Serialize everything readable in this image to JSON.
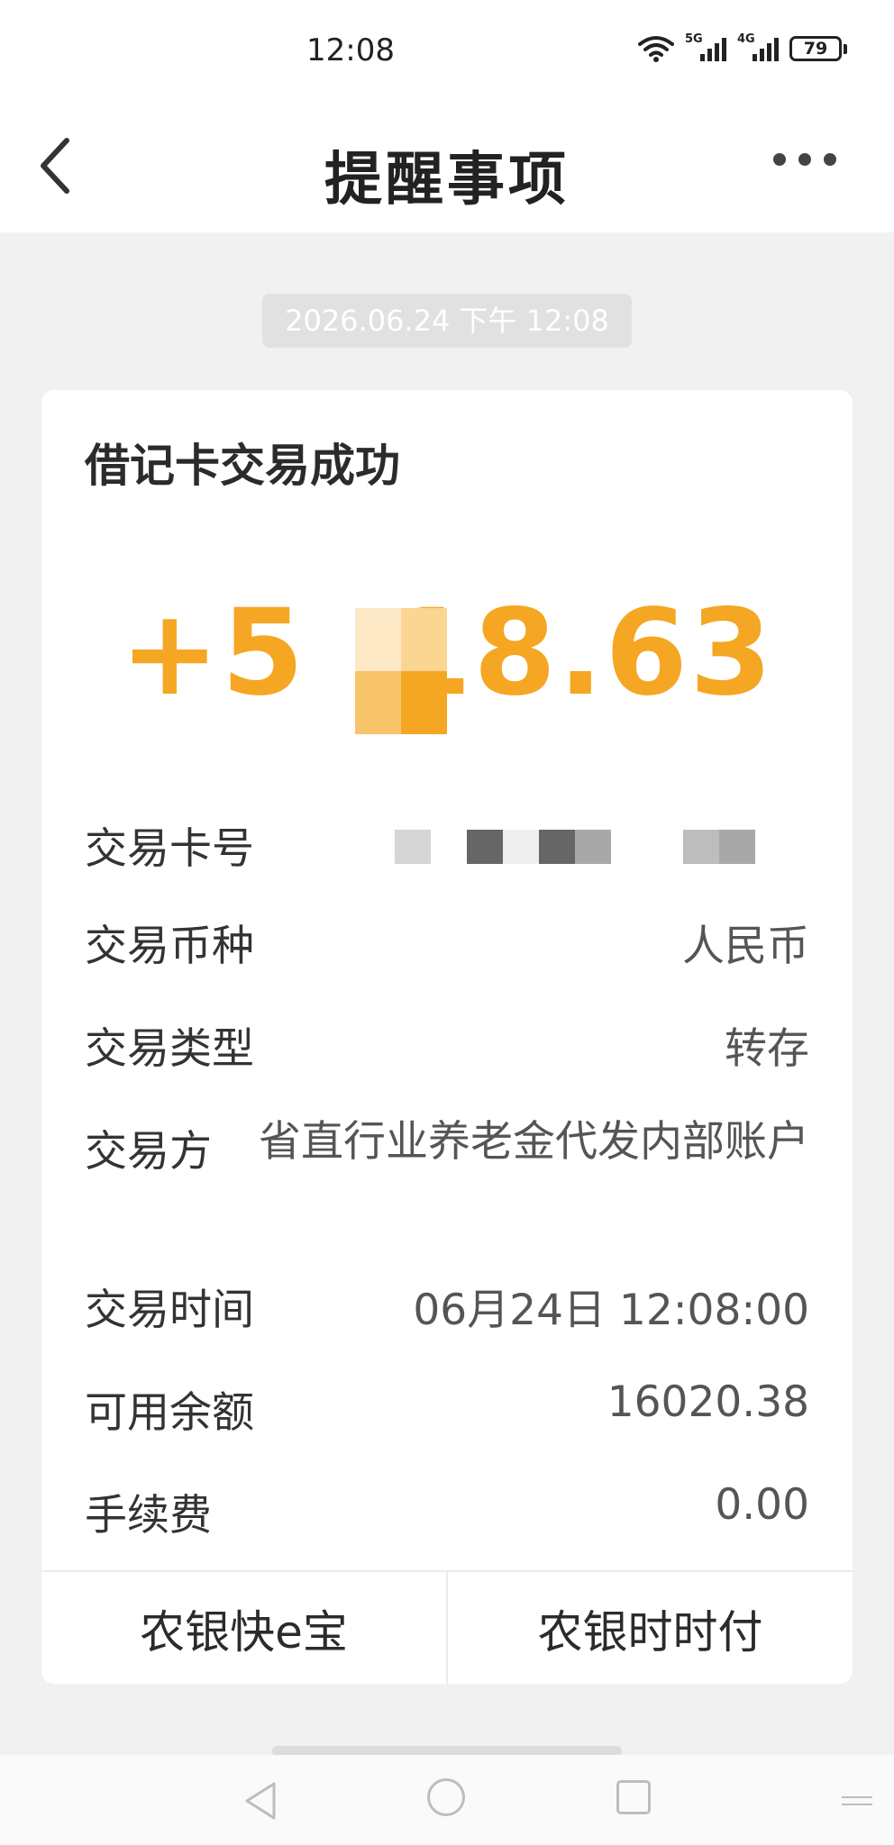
{
  "status_bar": {
    "time": "12:08",
    "signal_1_tag": "5G",
    "signal_2_tag": "4G",
    "battery": "79"
  },
  "header": {
    "title": "提醒事项"
  },
  "message_time": "2026.06.24 下午 12:08",
  "card": {
    "title": "借记卡交易成功",
    "amount_visible_prefix": "+5",
    "amount_visible_suffix": "18.63",
    "amount_color": "#f5a623",
    "rows": [
      {
        "label": "交易卡号",
        "value": ""
      },
      {
        "label": "交易币种",
        "value": "人民币"
      },
      {
        "label": "交易类型",
        "value": "转存"
      },
      {
        "label": "交易方",
        "value": "省直行业养老金代发内部账户"
      },
      {
        "label": "交易时间",
        "value": "06月24日 12:08:00"
      },
      {
        "label": "可用余额",
        "value": "16020.38"
      },
      {
        "label": "手续费",
        "value": "0.00"
      }
    ],
    "buttons": [
      {
        "label": "农银快e宝"
      },
      {
        "label": "农银时时付"
      }
    ]
  }
}
